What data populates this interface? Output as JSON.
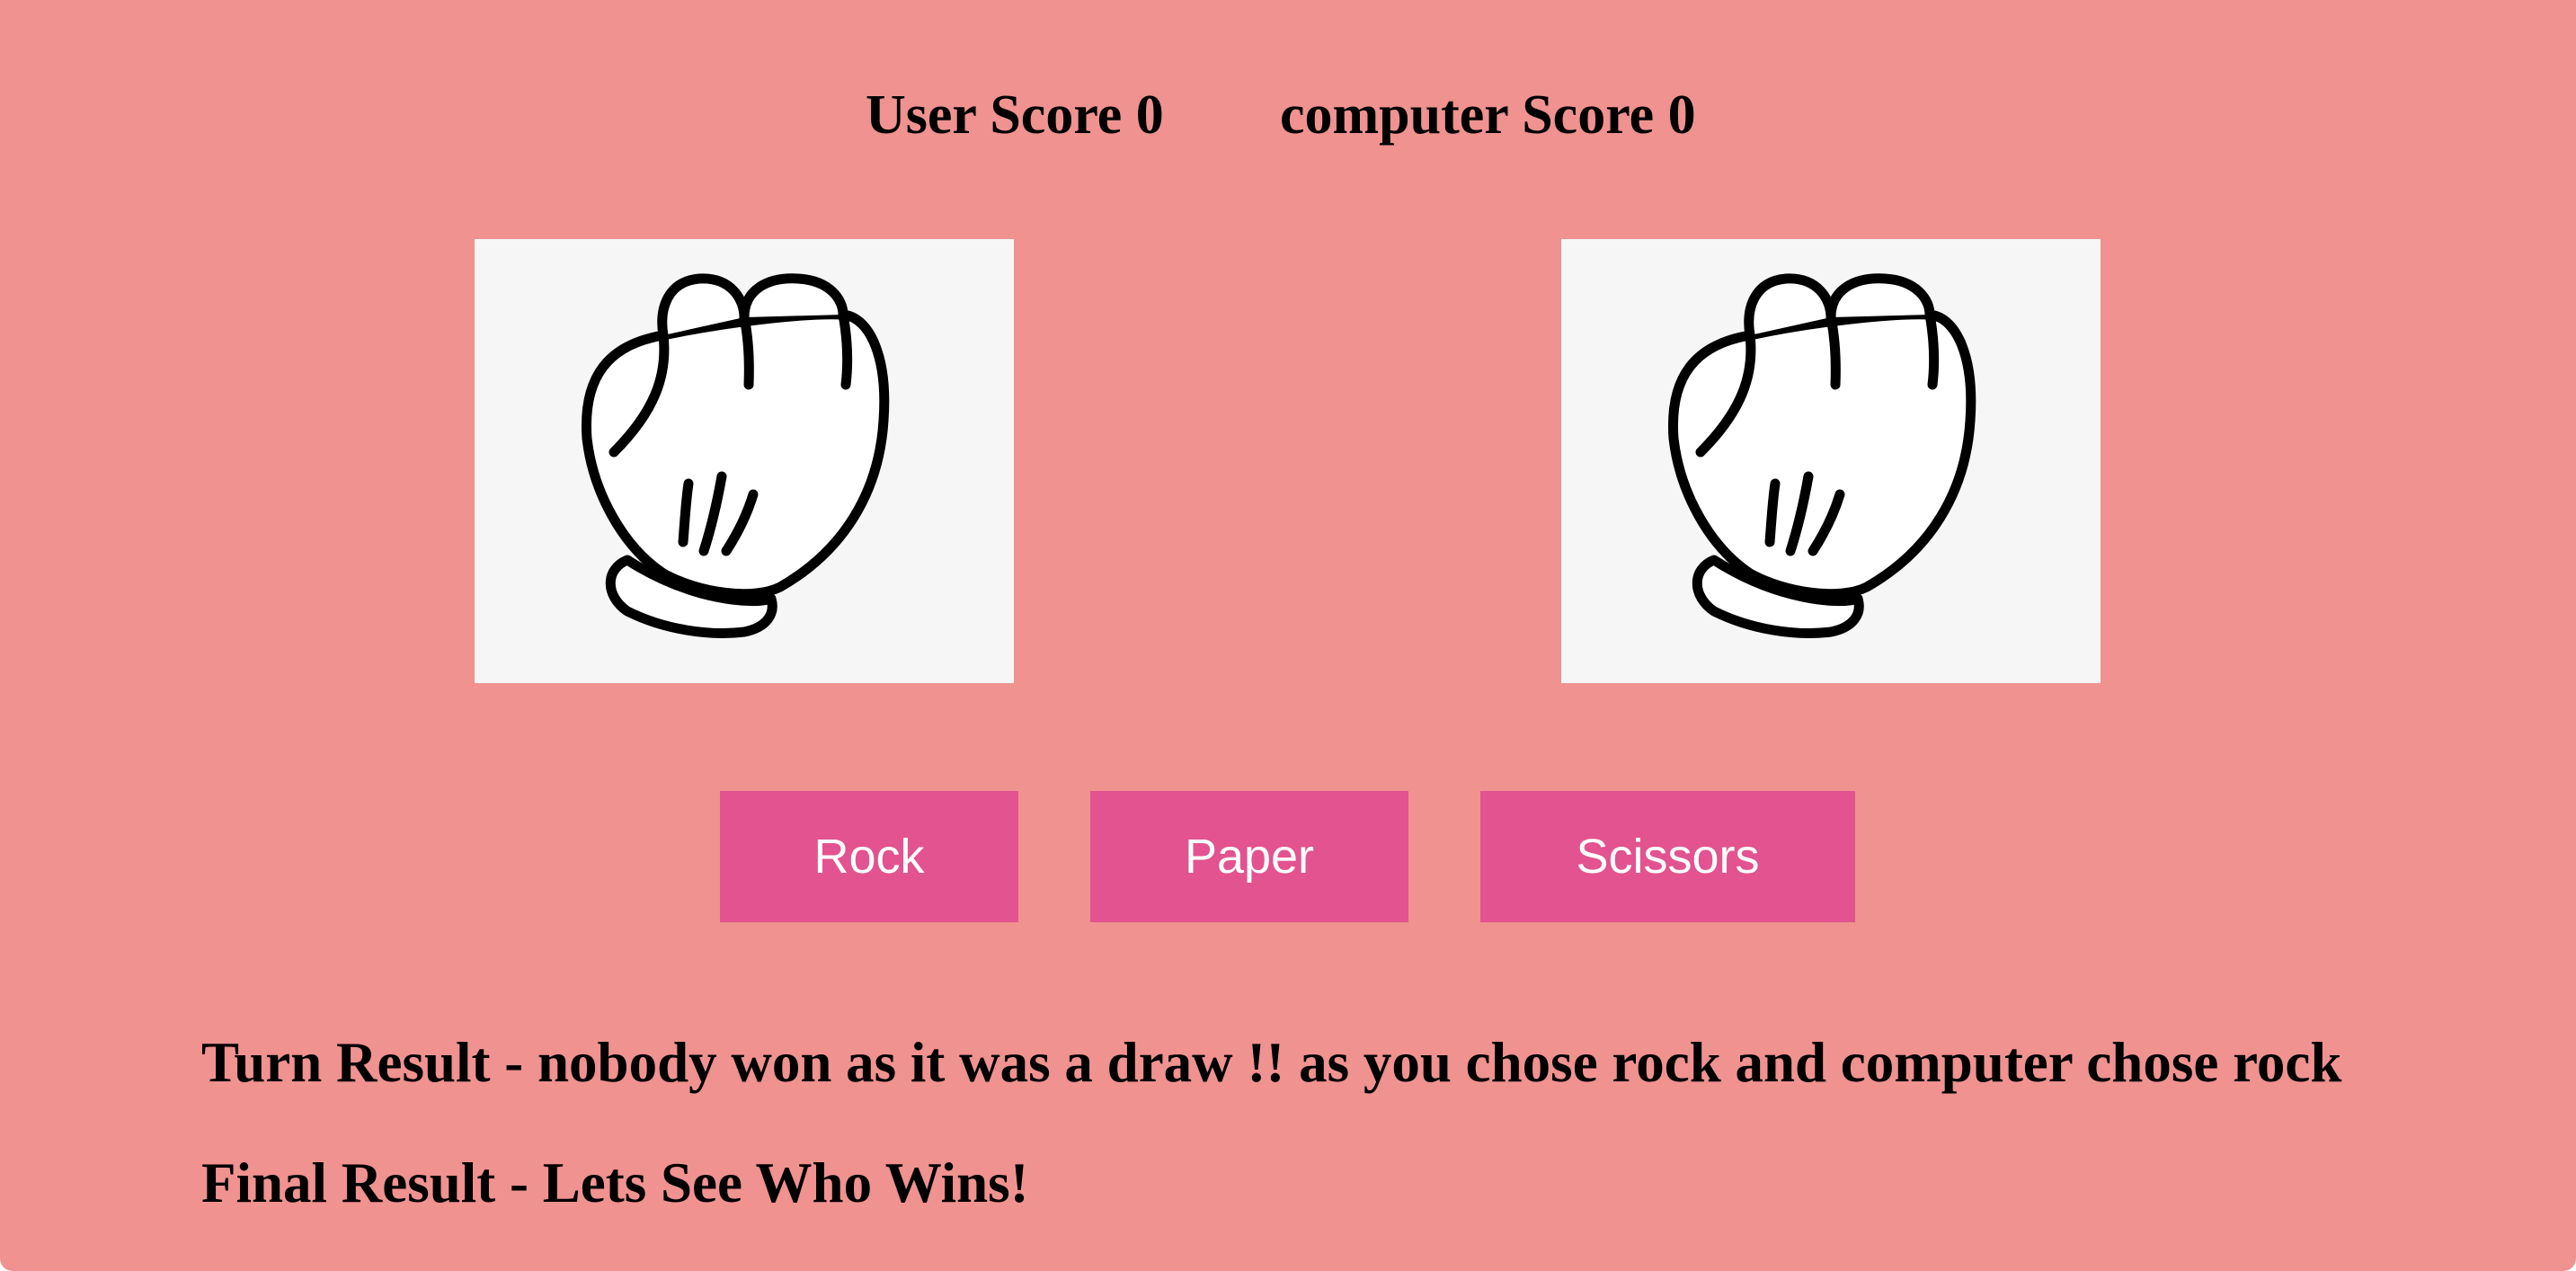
{
  "scores": {
    "user_label": "User Score 0",
    "computer_label": "computer Score 0"
  },
  "hands": {
    "user_icon": "rock-fist-icon",
    "computer_icon": "rock-fist-icon"
  },
  "buttons": {
    "rock": "Rock",
    "paper": "Paper",
    "scissors": "Scissors"
  },
  "results": {
    "turn": "Turn Result - nobody won as it was a draw !! as you chose rock and computer chose rock",
    "final": "Final Result - Lets See Who Wins!"
  },
  "colors": {
    "background": "#ef9290",
    "button": "#e2538f",
    "button_text": "#ffffff",
    "panel": "#f6f6f6"
  }
}
